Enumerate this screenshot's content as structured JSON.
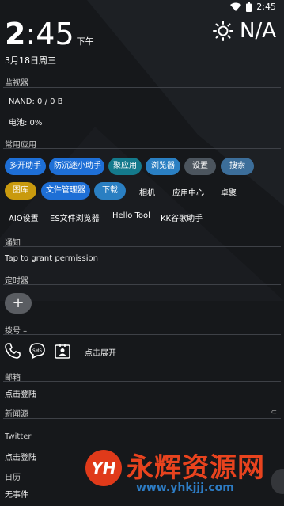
{
  "status_bar": {
    "time": "2:45"
  },
  "clock": {
    "hour": "2",
    "colon": ":",
    "minute": "45",
    "ampm": "下午",
    "date": "3月18日周三"
  },
  "weather": {
    "temp": "N/A",
    "icon": "sun-icon"
  },
  "monitor": {
    "title": "监视器",
    "nand": "NAND: 0 / 0 B",
    "battery": "电池: 0%"
  },
  "apps": {
    "title": "常用应用",
    "row1": [
      "多开助手",
      "防沉迷小助手",
      "聚应用",
      "浏览器",
      "设置",
      "搜索"
    ],
    "row2_chips": [
      "图库",
      "文件管理器",
      "下载"
    ],
    "row2_plain": [
      "相机",
      "应用中心",
      "卓聚"
    ],
    "row3": [
      "AIO设置",
      "ES文件浏览器",
      "Hello Tool",
      "KK谷歌助手"
    ]
  },
  "notifications": {
    "title": "通知",
    "text": "Tap to grant permission"
  },
  "timer": {
    "title": "定时器",
    "add": "+"
  },
  "dialer": {
    "title": "拨号 –",
    "expand": "点击展开"
  },
  "mail": {
    "title": "邮箱",
    "login": "点击登陆"
  },
  "news": {
    "title": "新闻源",
    "expand_glyph": "⊂"
  },
  "twitter": {
    "title": "Twitter",
    "login": "点击登陆"
  },
  "calendar": {
    "title": "日历",
    "text": "无事件"
  },
  "watermark": {
    "logo": "YH",
    "name": "永辉资源网",
    "url": "www.yhkjjj.com"
  },
  "colors": {
    "chip_blue": "#1e6fd6",
    "chip_gold": "#c99a0e",
    "background": "#16181b"
  }
}
